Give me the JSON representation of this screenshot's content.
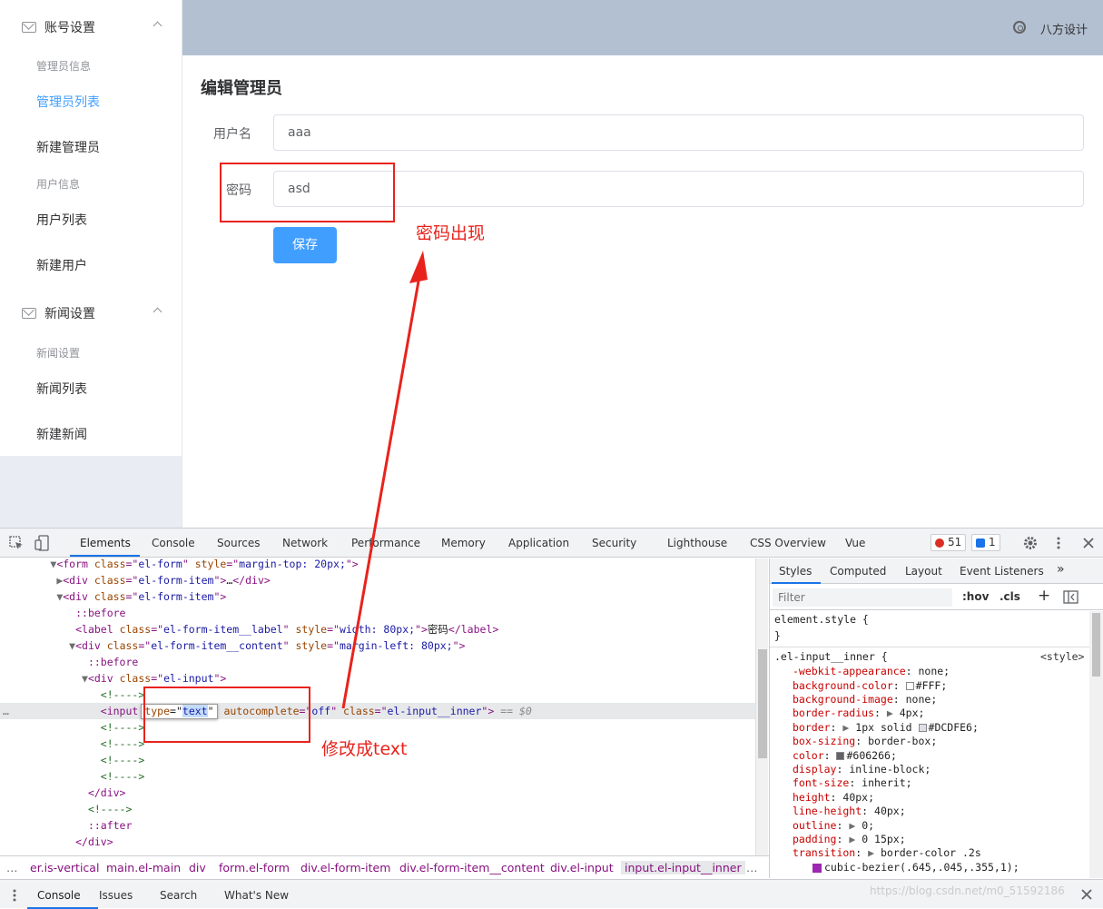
{
  "sidebar": {
    "groups": [
      {
        "title": "账号设置",
        "icon": "mail-icon"
      },
      {
        "title": "新闻设置",
        "icon": "mail-icon"
      }
    ],
    "items": [
      {
        "label": "管理员信息",
        "type": "group"
      },
      {
        "label": "管理员列表",
        "type": "item",
        "active": true
      },
      {
        "label": "新建管理员",
        "type": "item"
      },
      {
        "label": "用户信息",
        "type": "group"
      },
      {
        "label": "用户列表",
        "type": "item"
      },
      {
        "label": "新建用户",
        "type": "item"
      },
      {
        "label": "新闻设置",
        "type": "group"
      },
      {
        "label": "新闻列表",
        "type": "item"
      },
      {
        "label": "新建新闻",
        "type": "item"
      }
    ]
  },
  "header": {
    "user": "八方设计",
    "settings_icon": "gear-icon"
  },
  "form": {
    "title": "编辑管理员",
    "username_label": "用户名",
    "username_value": "aaa",
    "password_label": "密码",
    "password_value": "asd",
    "save_label": "保存"
  },
  "annotations": {
    "password_shown": "密码出现",
    "changed_to_text": "修改成text"
  },
  "devtools": {
    "tabs": [
      "Elements",
      "Console",
      "Sources",
      "Network",
      "Performance",
      "Memory",
      "Application",
      "Security",
      "Lighthouse",
      "CSS Overview",
      "Vue"
    ],
    "active_tab": "Elements",
    "error_count": "51",
    "message_count": "1",
    "style_tabs": [
      "Styles",
      "Computed",
      "Layout",
      "Event Listeners"
    ],
    "filter_placeholder": "Filter",
    "hov": ":hov",
    "cls": ".cls",
    "breadcrumbs": [
      "er.is-vertical",
      "main.el-main",
      "div",
      "form.el-form",
      "div.el-form-item",
      "div.el-form-item__content",
      "div.el-input",
      "input.el-input__inner"
    ],
    "drawer_tabs": [
      "Console",
      "Issues",
      "Search",
      "What's New"
    ],
    "watermark": "https://blog.csdn.net/m0_51592186",
    "colors": {
      "accent": "#1a73e8",
      "error": "#d93025",
      "primary": "#409eff",
      "annotation": "#e8231c"
    }
  }
}
